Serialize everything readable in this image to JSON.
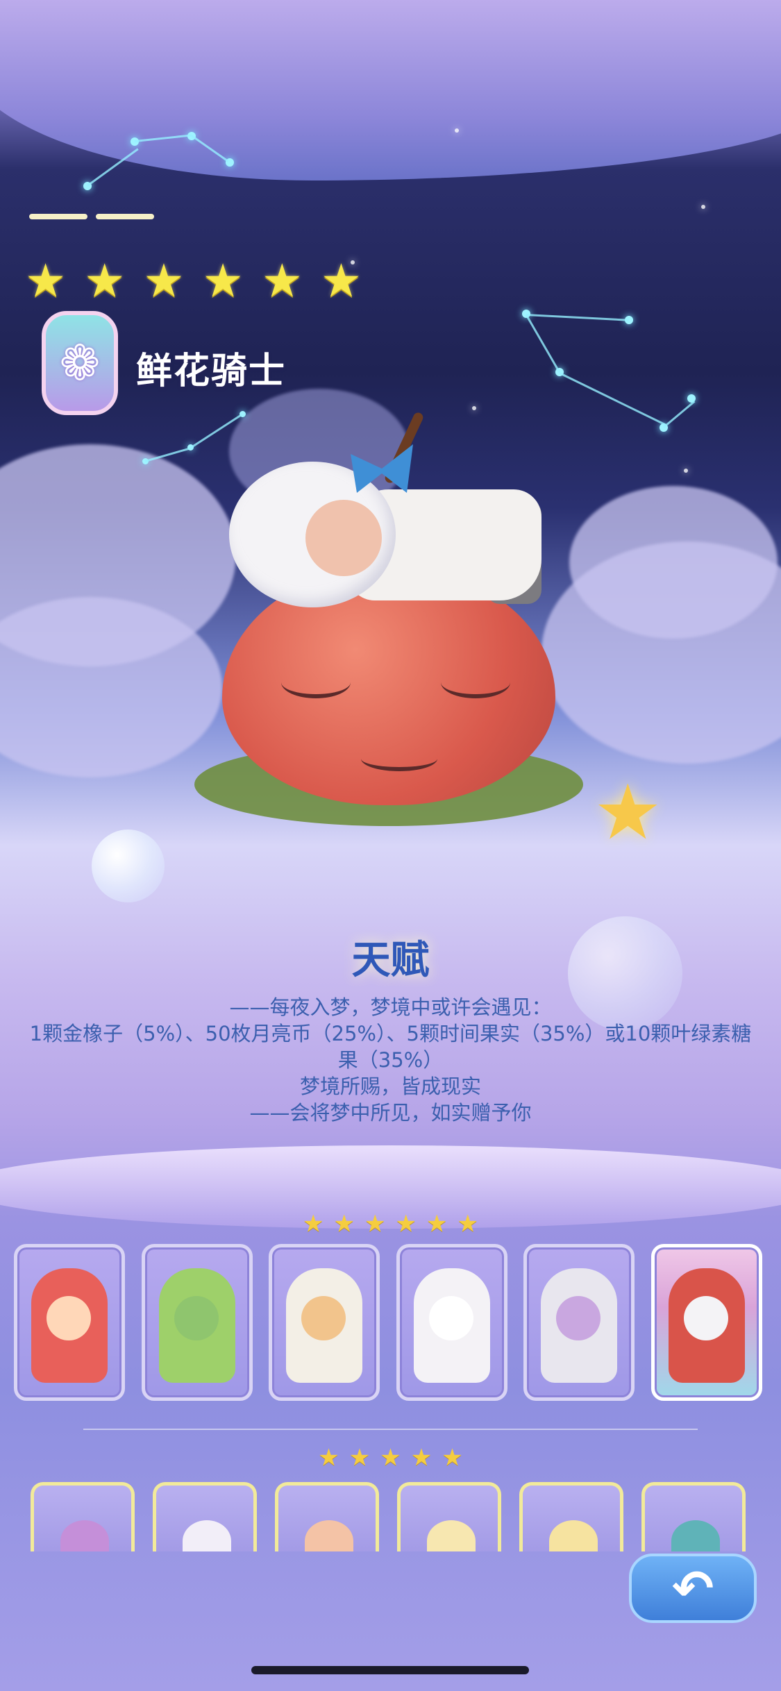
{
  "header": {
    "rarity_stars": 6,
    "character_name": "鲜花骑士",
    "clan_badge_icon": "flower-crest-icon"
  },
  "talent": {
    "heading": "天赋",
    "lines": [
      "——每夜入梦，梦境中或许会遇见：",
      "1颗金橡子（5%）、50枚月亮币（25%）、5颗时间果实（35%）或10颗叶绿素糖",
      "果（35%）",
      "梦境所赐，皆成现实",
      "——会将梦中所见，如实赠予你"
    ]
  },
  "roster": {
    "six_star": {
      "stars": 6,
      "cards": [
        {
          "name": "red-bunny-hood-character",
          "selected": false
        },
        {
          "name": "green-hood-scarf-character",
          "selected": false
        },
        {
          "name": "moon-pajama-boy-character",
          "selected": false
        },
        {
          "name": "white-ghost-character",
          "selected": false
        },
        {
          "name": "silver-hair-girl-character",
          "selected": false
        },
        {
          "name": "apple-sleeper-character",
          "selected": true
        }
      ]
    },
    "five_star": {
      "stars": 5,
      "cards": [
        {
          "name": "purple-dragon-character"
        },
        {
          "name": "unicorn-character"
        },
        {
          "name": "fox-character"
        },
        {
          "name": "chick-character"
        },
        {
          "name": "party-hat-character"
        },
        {
          "name": "teal-hair-character"
        }
      ]
    }
  },
  "controls": {
    "back_icon": "undo-arrow-icon",
    "back_symbol": "↶"
  },
  "colors": {
    "star": "#f7e84a",
    "talent_text": "#3b5fae",
    "back_button": "#4a8de6"
  }
}
